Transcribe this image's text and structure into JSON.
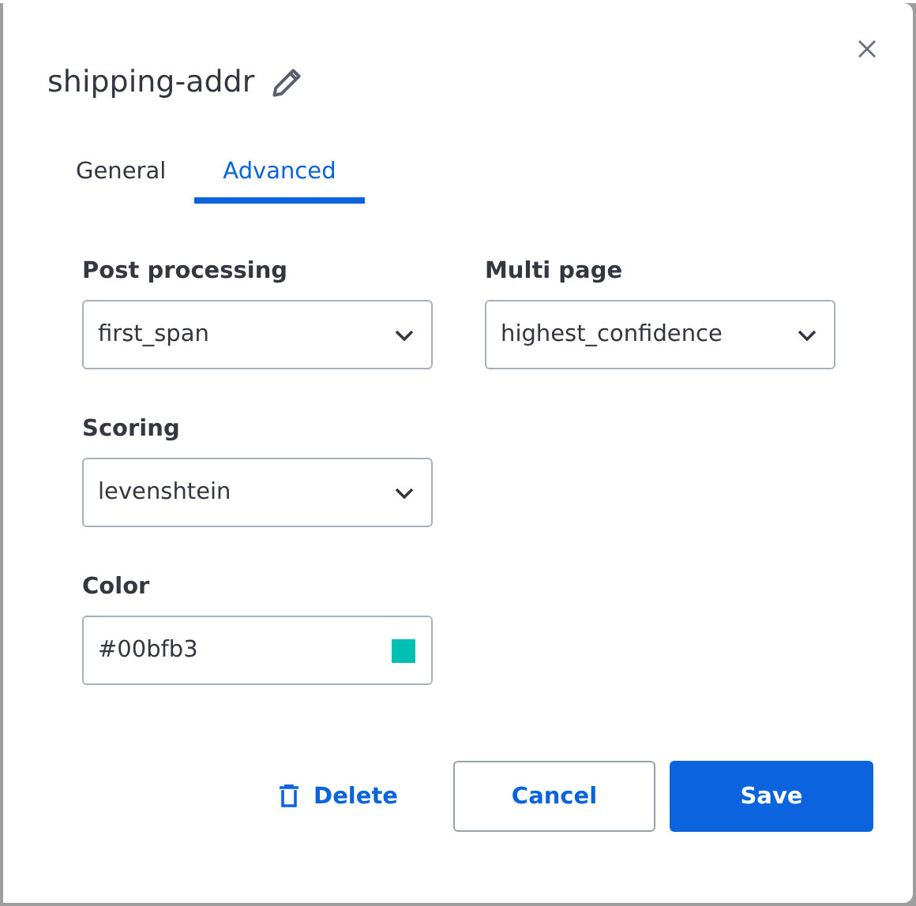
{
  "dialog": {
    "title": "shipping-addr"
  },
  "tabs": [
    {
      "label": "General",
      "selected": false
    },
    {
      "label": "Advanced",
      "selected": true
    }
  ],
  "fields": [
    {
      "kind": "select",
      "label": "Post processing",
      "value": "first_span"
    },
    {
      "kind": "select",
      "label": "Multi page",
      "value": "highest_confidence"
    },
    {
      "kind": "select",
      "label": "Scoring",
      "value": "levenshtein"
    },
    {
      "kind": "color",
      "label": "Color",
      "value": "#00bfb3",
      "color": "#00bfb3"
    }
  ],
  "buttons": {
    "delete": "Delete",
    "cancel": "Cancel",
    "save": "Save"
  }
}
